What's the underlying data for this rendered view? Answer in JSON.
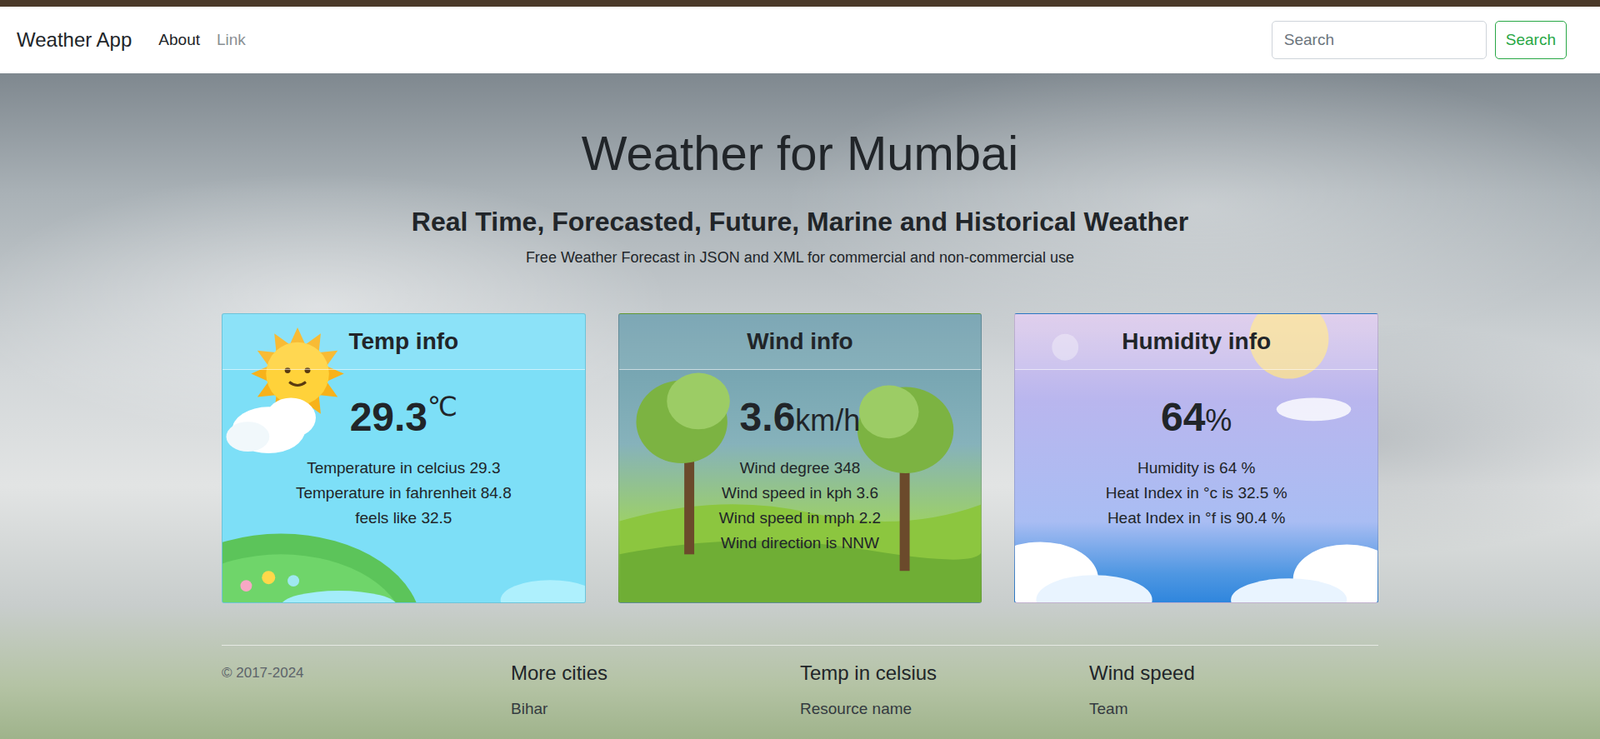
{
  "navbar": {
    "brand": "Weather App",
    "links": [
      {
        "label": "About",
        "selected": true
      },
      {
        "label": "Link",
        "selected": false
      }
    ],
    "search": {
      "placeholder": "Search",
      "button": "Search"
    }
  },
  "hero": {
    "title": "Weather for Mumbai",
    "subtitle": "Real Time, Forecasted, Future, Marine and Historical Weather",
    "tagline": "Free Weather Forecast in JSON and XML for commercial and non-commercial use"
  },
  "cards": [
    {
      "kind": "temp",
      "title": "Temp info",
      "value": "29.3",
      "unit": "℃",
      "lines": [
        "Temperature in celcius 29.3",
        "Temperature in fahrenheit 84.8",
        "feels like 32.5"
      ]
    },
    {
      "kind": "wind",
      "title": "Wind info",
      "value": "3.6",
      "unit": "km/h",
      "lines": [
        "Wind degree 348",
        "Wind speed in kph 3.6",
        "Wind speed in mph 2.2",
        "Wind direction is NNW"
      ]
    },
    {
      "kind": "humidity",
      "title": "Humidity info",
      "value": "64",
      "unit": "%",
      "lines": [
        "Humidity is 64 %",
        "Heat Index in °c is 32.5 %",
        "Heat Index in °f is 90.4 %"
      ]
    }
  ],
  "footer": {
    "copyright": "© 2017-2024",
    "columns": [
      {
        "heading": "More cities",
        "items": [
          "Bihar"
        ]
      },
      {
        "heading": "Temp in celsius",
        "items": [
          "Resource name"
        ]
      },
      {
        "heading": "Wind speed",
        "items": [
          "Team"
        ]
      }
    ]
  }
}
